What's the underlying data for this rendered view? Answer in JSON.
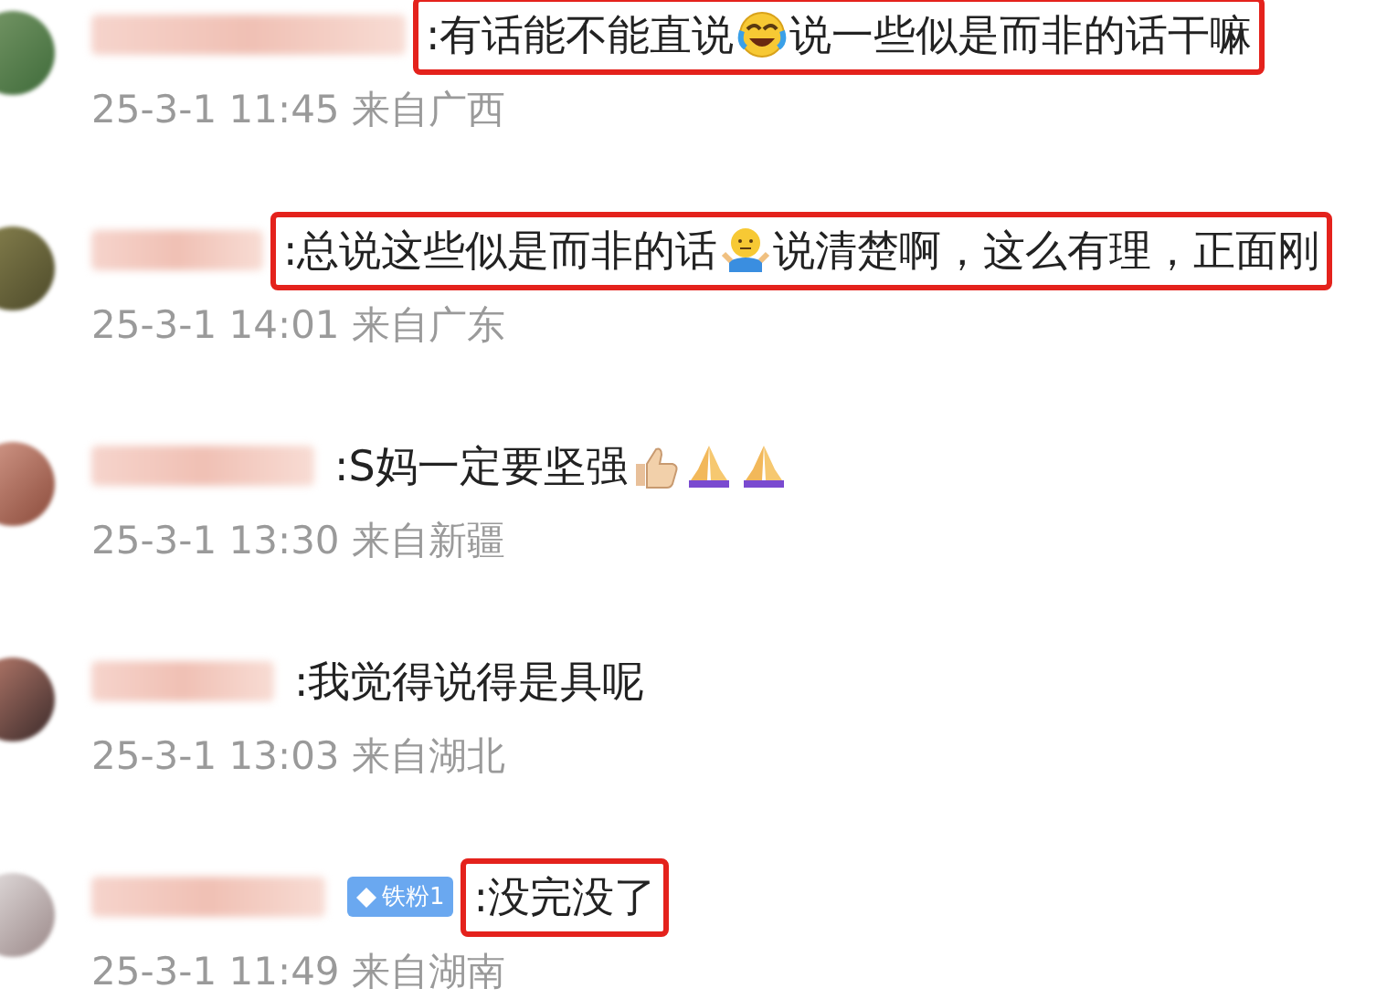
{
  "comments": [
    {
      "highlighted": true,
      "segments": [
        {
          "kind": "text",
          "text": ":有话能不能直说"
        },
        {
          "kind": "laugh-cry"
        },
        {
          "kind": "text",
          "text": "说一些似是而非的话干嘛"
        }
      ],
      "time": "25-3-1 11:45 来自广西"
    },
    {
      "highlighted": true,
      "segments": [
        {
          "kind": "text",
          "text": ":总说这些似是而非的话"
        },
        {
          "kind": "shrug"
        },
        {
          "kind": "text",
          "text": "说清楚啊，这么有理，正面刚"
        }
      ],
      "time": "25-3-1 14:01 来自广东"
    },
    {
      "highlighted": false,
      "segments": [
        {
          "kind": "text",
          "text": ":S妈一定要坚强"
        },
        {
          "kind": "thumbs-up"
        },
        {
          "kind": "pray"
        },
        {
          "kind": "pray"
        }
      ],
      "time": "25-3-1 13:30 来自新疆"
    },
    {
      "highlighted": false,
      "segments": [
        {
          "kind": "text",
          "text": ":我觉得说得是具呢"
        }
      ],
      "time": "25-3-1 13:03 来自湖北"
    },
    {
      "highlighted": true,
      "badge": {
        "text": "铁粉1"
      },
      "segments": [
        {
          "kind": "text",
          "text": ":没完没了"
        }
      ],
      "time": "25-3-1 11:49 来自湖南"
    }
  ]
}
